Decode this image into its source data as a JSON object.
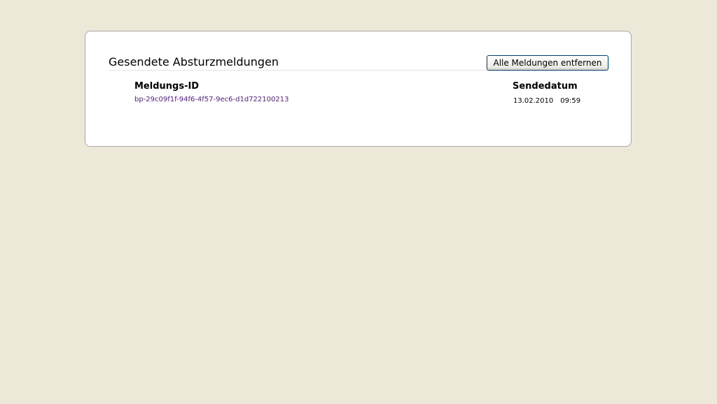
{
  "page": {
    "title": "Gesendete Absturzmeldungen",
    "clear_button_label": "Alle Meldungen entfernen"
  },
  "table": {
    "columns": {
      "id": "Meldungs-ID",
      "date": "Sendedatum"
    },
    "rows": [
      {
        "id": "bp-29c09f1f-94f6-4f57-9ec6-d1d722100213",
        "date": "13.02.2010",
        "time": "09:59"
      }
    ]
  },
  "colors": {
    "background": "#ece9d8",
    "panel": "#ffffff",
    "visited_link": "#551a8b",
    "button_border": "#003c74"
  }
}
